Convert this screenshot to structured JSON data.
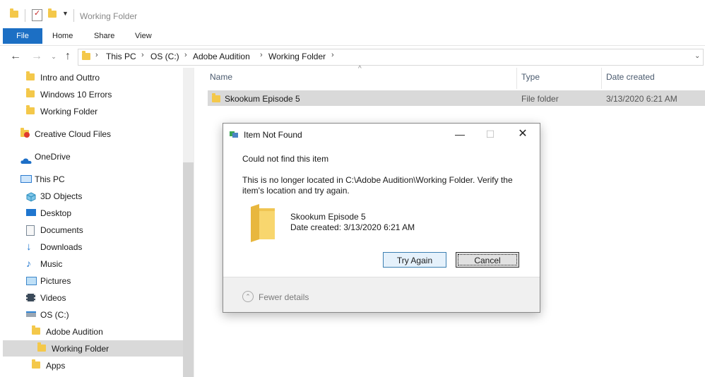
{
  "window": {
    "title": "Working Folder"
  },
  "ribbon": {
    "tabs": [
      "File",
      "Home",
      "Share",
      "View"
    ]
  },
  "address": {
    "crumbs": [
      "This PC",
      "OS (C:)",
      "Adobe Audition",
      "Working Folder"
    ]
  },
  "nav": {
    "items": [
      {
        "label": "Intro and Outtro",
        "icon": "folder-icon"
      },
      {
        "label": "Windows 10 Errors",
        "icon": "folder-icon"
      },
      {
        "label": "Working Folder",
        "icon": "folder-icon"
      },
      {
        "label": "Creative Cloud Files",
        "icon": "creative-cloud-icon"
      },
      {
        "label": "OneDrive",
        "icon": "onedrive-icon"
      },
      {
        "label": "This PC",
        "icon": "computer-icon"
      },
      {
        "label": "3D Objects",
        "icon": "3d-objects-icon"
      },
      {
        "label": "Desktop",
        "icon": "desktop-icon"
      },
      {
        "label": "Documents",
        "icon": "documents-icon"
      },
      {
        "label": "Downloads",
        "icon": "downloads-icon"
      },
      {
        "label": "Music",
        "icon": "music-icon"
      },
      {
        "label": "Pictures",
        "icon": "pictures-icon"
      },
      {
        "label": "Videos",
        "icon": "videos-icon"
      },
      {
        "label": "OS (C:)",
        "icon": "drive-icon"
      },
      {
        "label": "Adobe Audition",
        "icon": "folder-icon"
      },
      {
        "label": "Working Folder",
        "icon": "folder-icon"
      },
      {
        "label": "Apps",
        "icon": "folder-icon"
      }
    ]
  },
  "filelist": {
    "columns": [
      "Name",
      "Type",
      "Date created"
    ],
    "rows": [
      {
        "name": "Skookum Episode 5",
        "type": "File folder",
        "date": "3/13/2020 6:21 AM"
      }
    ]
  },
  "dialog": {
    "title": "Item Not Found",
    "heading": "Could not find this item",
    "message": "This is no longer located in C:\\Adobe Audition\\Working Folder. Verify the item's location and try again.",
    "item_name": "Skookum Episode 5",
    "item_date": "Date created: 3/13/2020 6:21 AM",
    "try_again": "Try Again",
    "cancel": "Cancel",
    "fewer_details": "Fewer details"
  },
  "colors": {
    "accent": "#1c6fc4",
    "folder": "#f4c84a",
    "selection": "#d9d9d9"
  }
}
